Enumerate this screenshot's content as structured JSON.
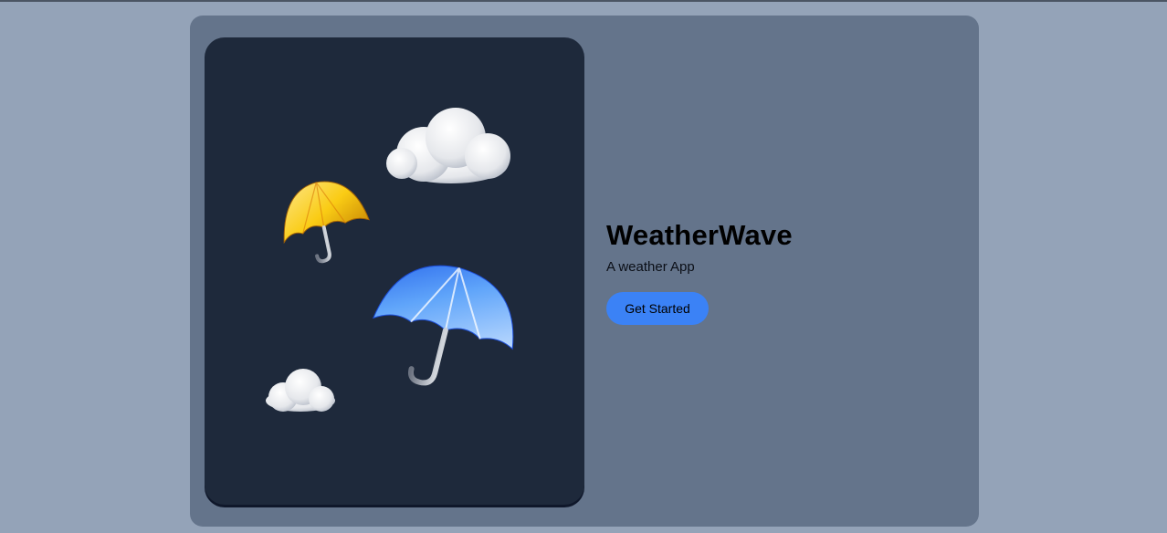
{
  "hero": {
    "title": "WeatherWave",
    "subtitle": "A weather App",
    "cta_label": "Get Started"
  },
  "colors": {
    "page_background": "#94a3b8",
    "card_background": "#64748b",
    "image_panel_background": "#1e293b",
    "accent": "#3b82f6"
  },
  "illustration": {
    "icons": [
      "cloud-icon",
      "yellow-umbrella-icon",
      "blue-umbrella-icon",
      "small-cloud-icon"
    ]
  }
}
